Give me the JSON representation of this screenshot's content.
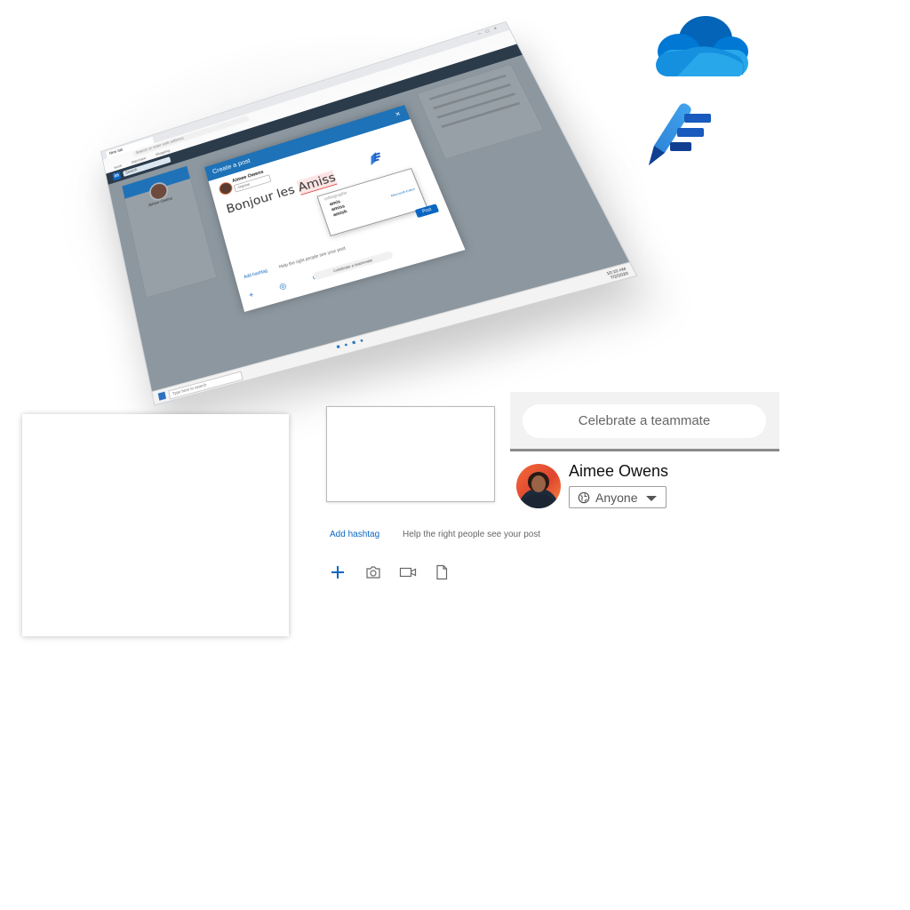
{
  "mockup": {
    "browser_tab": "New tab",
    "address_placeholder": "Search or enter web address",
    "favorites": [
      "Work",
      "Important",
      "Shopping"
    ],
    "linkedin_logo": "in",
    "linkedin_search": "Search",
    "left_card_name": "Aimee Owens",
    "modal": {
      "title": "Create a post",
      "close_icon": "×",
      "author": "Aimee Owens",
      "audience": "Anyone",
      "text_prefix": "Bonjour les ",
      "text_misspelled": "Amiss",
      "spell_header": "orthographe",
      "suggestions": [
        "amis",
        "amiss",
        "amish"
      ],
      "brand": "Microsoft Editor",
      "post_button": "Post",
      "add_hashtag": "Add hashtag",
      "help": "Help the right people see your post",
      "celebrate": "Celebrate a teammate"
    },
    "taskbar": {
      "search": "Type here to search",
      "time": "10:10 AM",
      "date": "7/2/2020"
    }
  },
  "icons": {
    "onedrive": "onedrive-cloud-icon",
    "editor": "microsoft-editor-pen-icon",
    "globe": "globe-icon",
    "plus": "plus-icon",
    "camera": "camera-icon",
    "video": "video-icon",
    "document": "document-icon"
  },
  "colors": {
    "linkedin_blue": "#0a66c2",
    "onedrive_light": "#28a8ea",
    "onedrive_dark": "#0364b8",
    "editor_blue": "#185abd"
  },
  "celebrate": {
    "label": "Celebrate a teammate"
  },
  "author": {
    "name": "Aimee Owens",
    "audience": "Anyone"
  },
  "composer": {
    "add_hashtag": "Add hashtag",
    "hashtag_help": "Help the right people see your post"
  }
}
